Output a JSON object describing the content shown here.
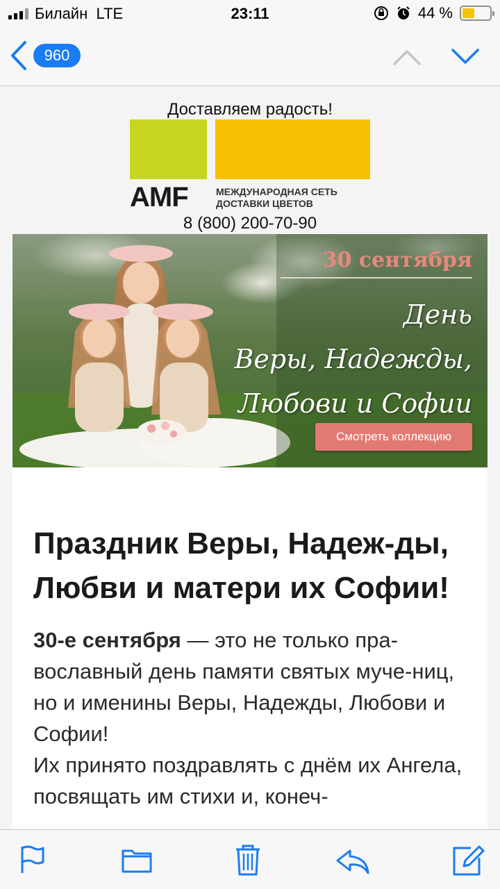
{
  "status_bar": {
    "carrier": "Билайн",
    "network": "LTE",
    "time": "23:11",
    "battery_text": "44 %",
    "battery_level": 0.44
  },
  "nav": {
    "back_count": "960",
    "icons": [
      "chevron-left-icon",
      "chevron-up-icon",
      "chevron-down-icon"
    ]
  },
  "email": {
    "tagline": "Доставляем радость!",
    "logo": {
      "brand": "AMF",
      "network_line1": "МЕЖДУНАРОДНАЯ СЕТЬ",
      "network_line2": "ДОСТАВКИ ЦВЕТОВ"
    },
    "phone": "8 (800) 200-70-90",
    "banner": {
      "date": "30 сентября",
      "line1": "День",
      "line2": "Веры, Надежды,",
      "line3": "Любови и Софии",
      "button": "Смотреть коллекцию"
    },
    "article": {
      "title": "Праздник Веры, Надеж-ды, Любви и матери их Софии!",
      "lead_bold": "30-е сентября",
      "lead_rest": " — это не только пра-вославный день памяти святых муче-ниц, но и именины Веры, Надежды, Любови и Софии!",
      "para2": "Их принято поздравлять с днём их Ангела, посвящать им стихи и, конеч-"
    }
  },
  "toolbar": {
    "icons": [
      "flag-icon",
      "folder-icon",
      "trash-icon",
      "reply-icon",
      "compose-icon"
    ]
  },
  "colors": {
    "accent": "#1a7cf2",
    "logo_green": "#c7d520",
    "logo_yellow": "#f7c000",
    "banner_pink": "#e27a74"
  }
}
